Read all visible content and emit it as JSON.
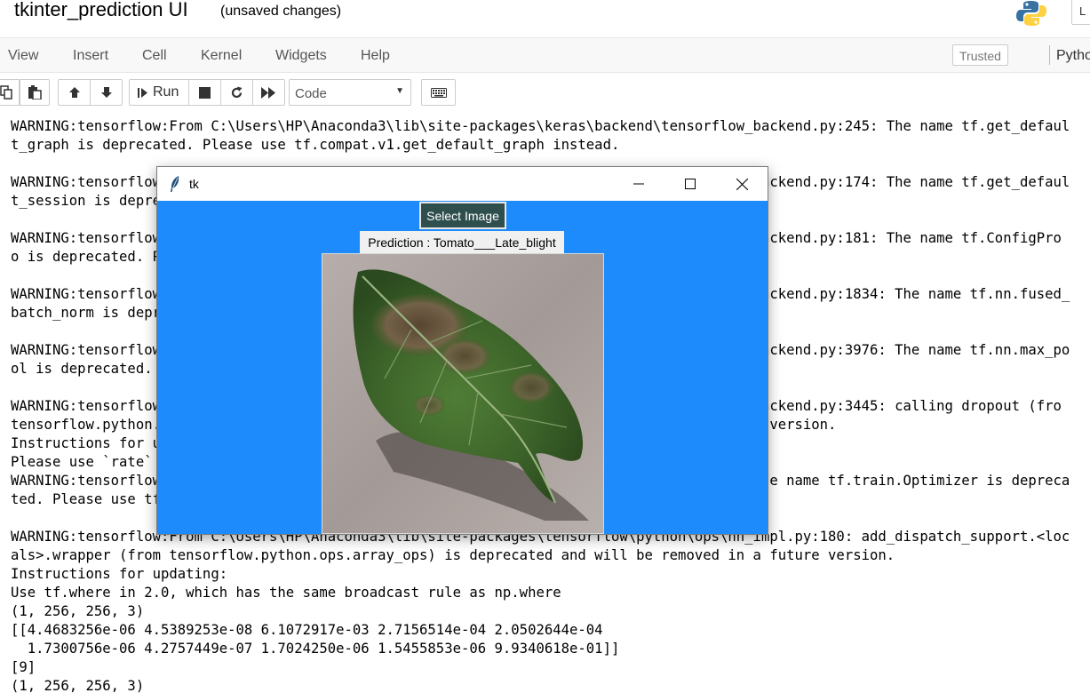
{
  "header": {
    "notebook_title": "tkinter_prediction UI",
    "save_status": "(unsaved changes)",
    "logout_label": "L"
  },
  "menubar": {
    "items": [
      "View",
      "Insert",
      "Cell",
      "Kernel",
      "Widgets",
      "Help"
    ],
    "trusted_label": "Trusted",
    "kernel_label": "Pytho"
  },
  "toolbar": {
    "run_label": "Run",
    "cell_type": "Code"
  },
  "output": {
    "lines": [
      "WARNING:tensorflow:From C:\\Users\\HP\\Anaconda3\\lib\\site-packages\\keras\\backend\\tensorflow_backend.py:245: The name tf.get_defaul",
      "t_graph is deprecated. Please use tf.compat.v1.get_default_graph instead.",
      "",
      "WARNING:tensorflow:From C:\\Users\\HP\\Anaconda3\\lib\\site-packages\\keras\\backend\\tensorflow_backend.py:174: The name tf.get_defaul",
      "t_session is deprecated. Please use tf.compat.v1.get_default_session instead.",
      "",
      "WARNING:tensorflow:From C:\\Users\\HP\\Anaconda3\\lib\\site-packages\\keras\\backend\\tensorflow_backend.py:181: The name tf.ConfigPro",
      "o is deprecated. Please use tf.compat.v1.ConfigProto instead.",
      "",
      "WARNING:tensorflow:From C:\\Users\\HP\\Anaconda3\\lib\\site-packages\\keras\\backend\\tensorflow_backend.py:1834: The name tf.nn.fused_",
      "batch_norm is deprecated. Please use tf.compat.v1.nn.fused_batch_norm instead.",
      "",
      "WARNING:tensorflow:From C:\\Users\\HP\\Anaconda3\\lib\\site-packages\\keras\\backend\\tensorflow_backend.py:3976: The name tf.nn.max_po",
      "ol is deprecated. Please use tf.nn.max_pool2d instead.",
      "",
      "WARNING:tensorflow:From C:\\Users\\HP\\Anaconda3\\lib\\site-packages\\keras\\backend\\tensorflow_backend.py:3445: calling dropout (fro",
      "tensorflow.python.ops.nn_ops) with keep_prob is deprecated and will be removed in a future version.",
      "Instructions for updating:",
      "Please use `rate` instead of `keep_prob`. Rate should be set to `rate = 1 - keep_prob`.",
      "WARNING:tensorflow:From C:\\Users\\HP\\Anaconda3\\lib\\site-packages\\keras\\optimizers.py:790: The name tf.train.Optimizer is depreca",
      "ted. Please use tf.compat.v1.train.Optimizer instead.",
      "",
      "WARNING:tensorflow:From C:\\Users\\HP\\Anaconda3\\lib\\site-packages\\tensorflow\\python\\ops\\nn_impl.py:180: add_dispatch_support.<loc",
      "als>.wrapper (from tensorflow.python.ops.array_ops) is deprecated and will be removed in a future version.",
      "Instructions for updating:",
      "Use tf.where in 2.0, which has the same broadcast rule as np.where",
      "(1, 256, 256, 3)",
      "[[4.4683256e-06 4.5389253e-08 6.1072917e-03 2.7156514e-04 2.0502644e-04",
      "  1.7300756e-06 4.2757449e-07 1.7024250e-06 1.5455853e-06 9.9340618e-01]]",
      "[9]",
      "(1, 256, 256, 3)"
    ]
  },
  "tk_window": {
    "title": "tk",
    "select_button_label": "Select Image",
    "prediction_text": "Prediction : Tomato___Late_blight",
    "background_color": "#1e8bfc"
  }
}
